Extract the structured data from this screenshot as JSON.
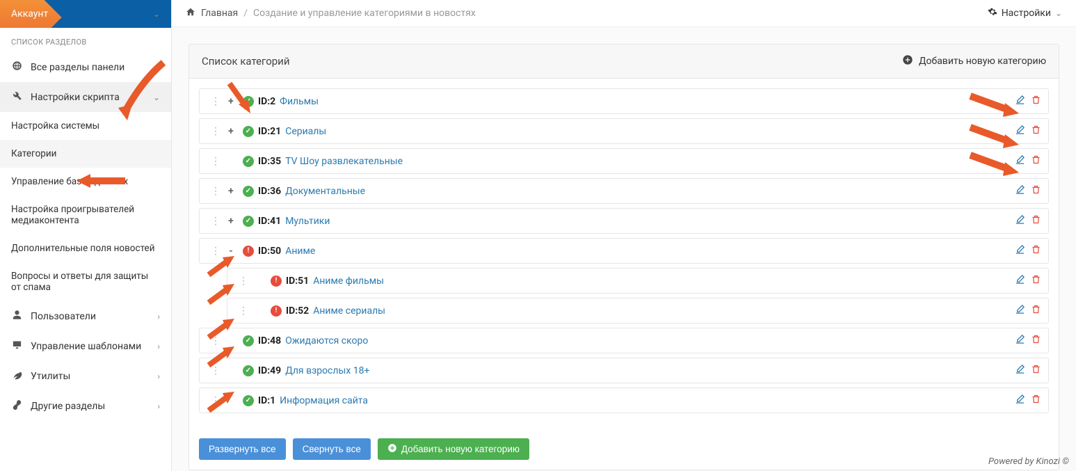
{
  "sidebar": {
    "account_label": "Аккаунт",
    "section_heading": "СПИСОК РАЗДЕЛОВ",
    "items": [
      {
        "icon": "globe",
        "label": "Все разделы панели",
        "expandable": false
      },
      {
        "icon": "wrench",
        "label": "Настройки скрипта",
        "expandable": true
      },
      {
        "icon": "user",
        "label": "Пользователи",
        "expandable": true
      },
      {
        "icon": "desktop",
        "label": "Управление шаблонами",
        "expandable": true
      },
      {
        "icon": "leaf",
        "label": "Утилиты",
        "expandable": true
      },
      {
        "icon": "link",
        "label": "Другие разделы",
        "expandable": true
      }
    ],
    "subitems": [
      "Настройка системы",
      "Категории",
      "Управление базой данных",
      "Настройка проигрывателей медиаконтента",
      "Дополнительные поля новостей",
      "Вопросы и ответы для защиты от спама"
    ]
  },
  "topbar": {
    "home": "Главная",
    "current": "Создание и управление категориями в новостях",
    "settings": "Настройки"
  },
  "panel": {
    "title": "Список категорий",
    "add_label": "Добавить новую категорию"
  },
  "categories": [
    {
      "indent": 0,
      "toggle": "+",
      "status": "ok",
      "id": "ID:2",
      "name": "Фильмы"
    },
    {
      "indent": 0,
      "toggle": "+",
      "status": "ok",
      "id": "ID:21",
      "name": "Сериалы"
    },
    {
      "indent": 0,
      "toggle": "",
      "status": "ok",
      "id": "ID:35",
      "name": "TV Шоу развлекательные"
    },
    {
      "indent": 0,
      "toggle": "+",
      "status": "ok",
      "id": "ID:36",
      "name": "Документальные"
    },
    {
      "indent": 0,
      "toggle": "+",
      "status": "ok",
      "id": "ID:41",
      "name": "Мультики"
    },
    {
      "indent": 0,
      "toggle": "-",
      "status": "err",
      "id": "ID:50",
      "name": "Аниме"
    },
    {
      "indent": 1,
      "toggle": "",
      "status": "err",
      "id": "ID:51",
      "name": "Аниме фильмы"
    },
    {
      "indent": 1,
      "toggle": "",
      "status": "err",
      "id": "ID:52",
      "name": "Аниме сериалы"
    },
    {
      "indent": 0,
      "toggle": "",
      "status": "ok",
      "id": "ID:48",
      "name": "Ожидаются скоро"
    },
    {
      "indent": 0,
      "toggle": "",
      "status": "ok",
      "id": "ID:49",
      "name": "Для взрослых 18+"
    },
    {
      "indent": 0,
      "toggle": "",
      "status": "ok",
      "id": "ID:1",
      "name": "Информация сайта"
    }
  ],
  "buttons": {
    "expand_all": "Развернуть все",
    "collapse_all": "Свернуть все",
    "add_new": "Добавить новую категорию"
  },
  "footer": "Powered by Kinozi ©"
}
